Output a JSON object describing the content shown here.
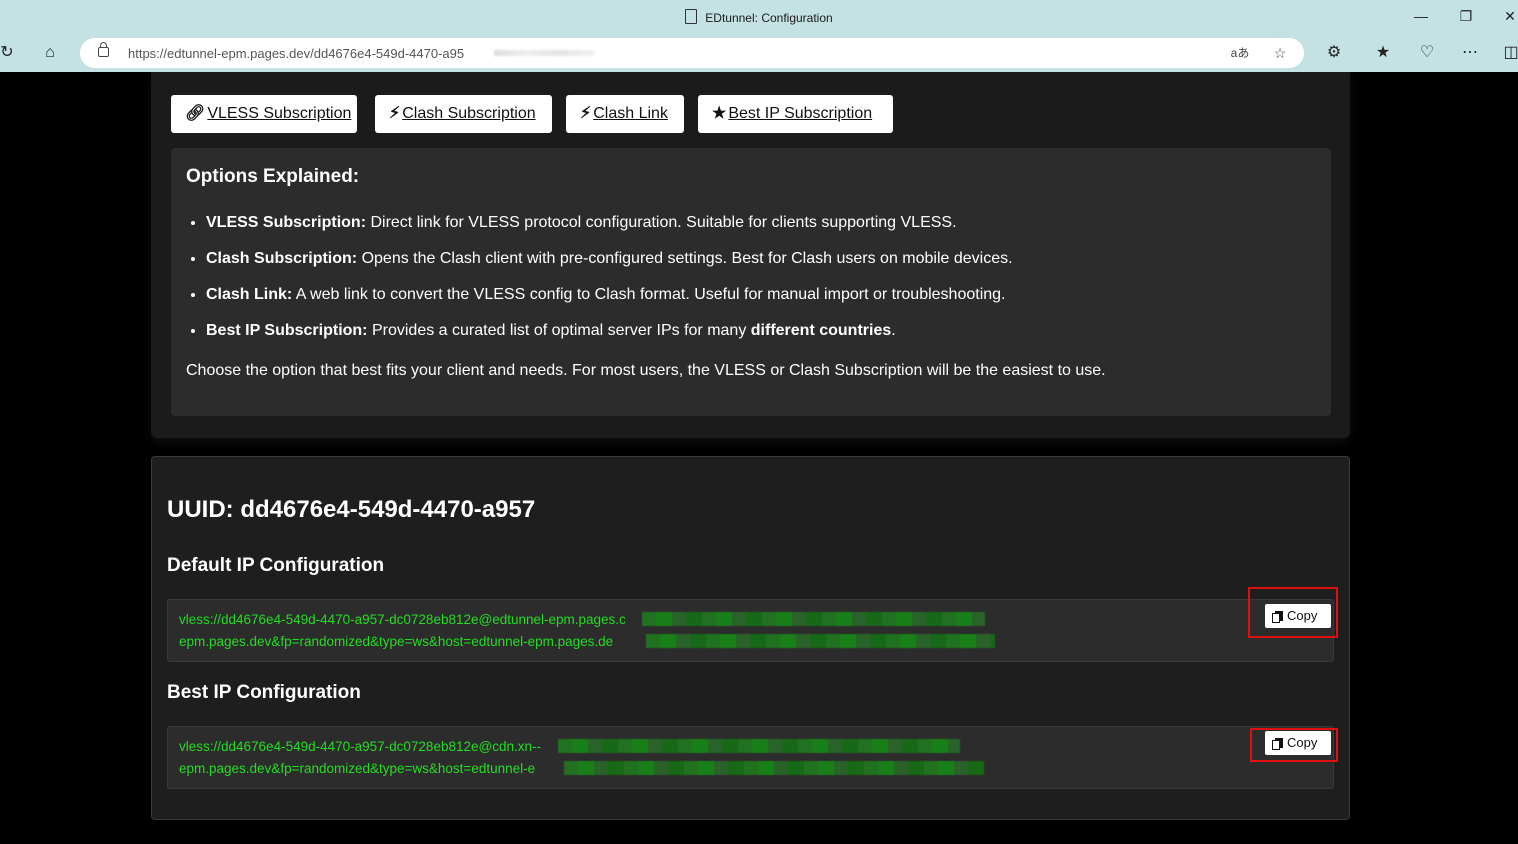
{
  "browser": {
    "tab_title": "EDtunnel: Configuration",
    "url": "https://edtunnel-epm.pages.dev/dd4676e4-549d-4470-a95"
  },
  "buttons": {
    "vless": "VLESS Subscription",
    "clash": "Clash Subscription",
    "clash_link": "Clash Link",
    "best_ip": "Best IP Subscription"
  },
  "explain": {
    "heading": "Options Explained:",
    "items": [
      {
        "term": "VLESS Subscription:",
        "text": " Direct link for VLESS protocol configuration. Suitable for clients supporting VLESS."
      },
      {
        "term": "Clash Subscription:",
        "text": " Opens the Clash client with pre-configured settings. Best for Clash users on mobile devices."
      },
      {
        "term": "Clash Link:",
        "text": " A web link to convert the VLESS config to Clash format. Useful for manual import or troubleshooting."
      },
      {
        "term": "Best IP Subscription:",
        "text": " Provides a curated list of optimal server IPs for many ",
        "bold_tail": "different countries",
        "end": "."
      }
    ],
    "footer": "Choose the option that best fits your client and needs. For most users, the VLESS or Clash Subscription will be the easiest to use."
  },
  "config": {
    "uuid_label": "UUID: dd4676e4-549d-4470-a957",
    "default_heading": "Default IP Configuration",
    "default_line1": "vless://dd4676e4-549d-4470-a957-dc0728eb812e@edtunnel-epm.pages.c",
    "default_line2": "epm.pages.dev&fp=randomized&type=ws&host=edtunnel-epm.pages.de",
    "best_heading": "Best IP Configuration",
    "best_line1": "vless://dd4676e4-549d-4470-a957-dc0728eb812e@cdn.xn--",
    "best_line2": "epm.pages.dev&fp=randomized&type=ws&host=edtunnel-e",
    "copy_label": "Copy"
  },
  "colors": {
    "chrome": "#c4e2e3",
    "config_text": "#22dd22",
    "highlight": "#e01010"
  }
}
